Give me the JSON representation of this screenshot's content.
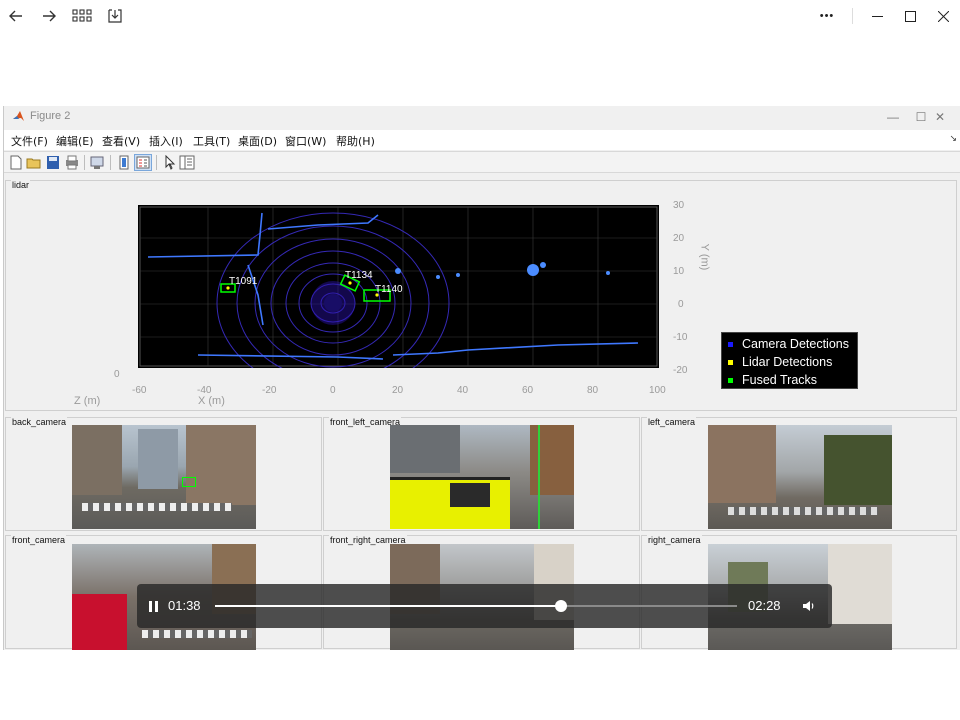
{
  "viewer": {
    "back_icon": "arrow-left-icon",
    "forward_icon": "arrow-right-icon",
    "grid_icon": "grid-icon",
    "save_icon": "download-icon",
    "more_label": "•••"
  },
  "figure": {
    "title": "Figure 2",
    "menus": [
      "文件(F)",
      "编辑(E)",
      "查看(V)",
      "插入(I)",
      "工具(T)",
      "桌面(D)",
      "窗口(W)",
      "帮助(H)"
    ],
    "menu_arrow": "↘"
  },
  "lidar": {
    "panel_label": "lidar",
    "legend": [
      {
        "label": "Camera Detections",
        "color": "#1a1aff"
      },
      {
        "label": "Lidar Detections",
        "color": "#ffff00"
      },
      {
        "label": "Fused Tracks",
        "color": "#00ff00"
      }
    ],
    "tracks": [
      "T1091",
      "T1134",
      "T1140"
    ],
    "x_ticks": [
      "-60",
      "-40",
      "-20",
      "0",
      "20",
      "40",
      "60",
      "80",
      "100"
    ],
    "y_ticks": [
      "30",
      "20",
      "10",
      "0",
      "-10",
      "-20"
    ],
    "z_tick": "0",
    "x_axis_label": "X (m)",
    "y_axis_label": "Y (m)",
    "z_axis_label": "Z (m)"
  },
  "cameras": {
    "back": "back_camera",
    "front_left": "front_left_camera",
    "left": "left_camera",
    "front": "front_camera",
    "front_right": "front_right_camera",
    "right": "right_camera"
  },
  "player": {
    "current_time": "01:38",
    "total_time": "02:28",
    "progress": 0.662
  }
}
